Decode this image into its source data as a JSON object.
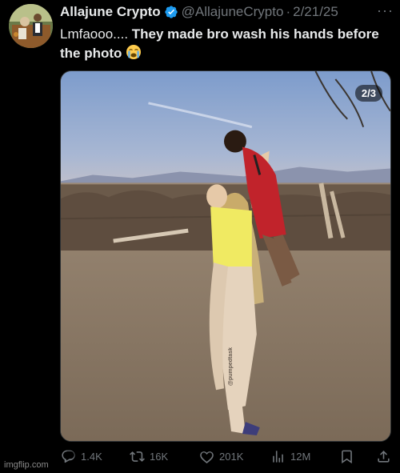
{
  "author": {
    "display_name": "Allajune Crypto",
    "handle": "@AllajuneCrypto",
    "separator": "·",
    "date": "2/21/25",
    "verified_color": "#1d9bf0"
  },
  "menu": {
    "more_label": "···"
  },
  "tweet": {
    "text_lead": "Lmfaooo.... ",
    "text_bold": "They made bro wash his hands before the photo",
    "emoji": "loudly-crying-face-icon"
  },
  "media": {
    "counter": "2/3",
    "watermark": "@pumpedtask"
  },
  "actions": {
    "replies": "1.4K",
    "reposts": "16K",
    "likes": "201K",
    "views": "12M"
  },
  "footer": {
    "watermark": "imgflip.com"
  },
  "colors": {
    "background": "#000000",
    "muted": "#71767b",
    "text": "#e7e9ea",
    "accent": "#1d9bf0"
  }
}
